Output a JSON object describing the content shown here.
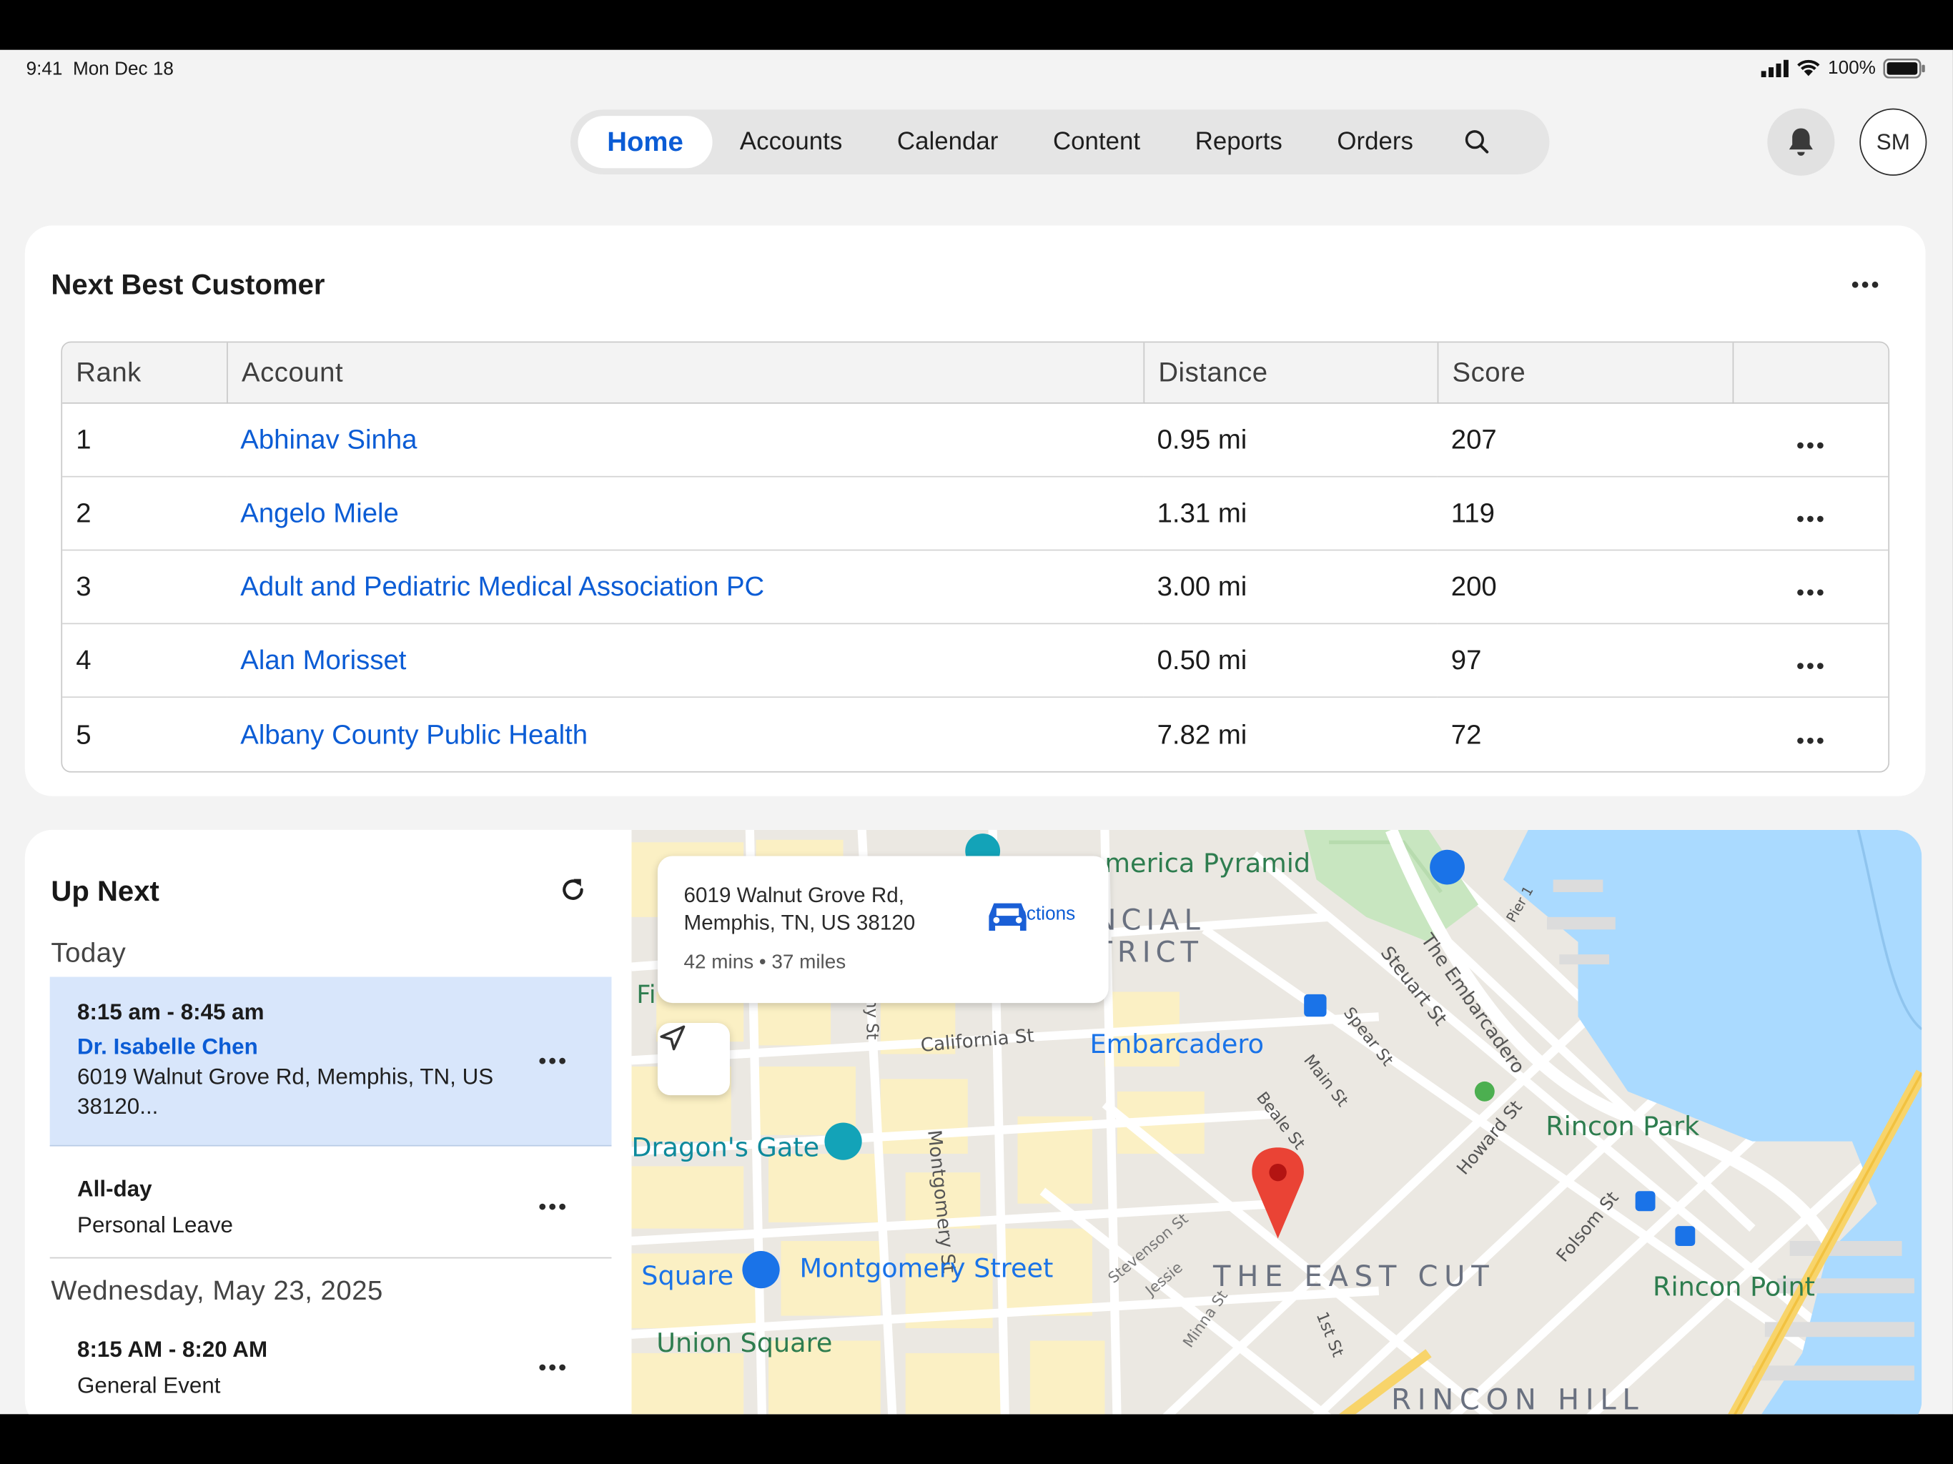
{
  "status": {
    "time": "9:41",
    "date": "Mon Dec 18",
    "battery": "100%"
  },
  "nav": {
    "tabs": [
      "Home",
      "Accounts",
      "Calendar",
      "Content",
      "Reports",
      "Orders"
    ],
    "active": "Home",
    "avatar_initials": "SM"
  },
  "nbc": {
    "title": "Next Best Customer",
    "columns": [
      "Rank",
      "Account",
      "Distance",
      "Score",
      ""
    ],
    "rows": [
      {
        "rank": "1",
        "account": "Abhinav Sinha",
        "distance": "0.95 mi",
        "score": "207"
      },
      {
        "rank": "2",
        "account": "Angelo Miele",
        "distance": "1.31 mi",
        "score": "119"
      },
      {
        "rank": "3",
        "account": "Adult and Pediatric Medical Association PC",
        "distance": "3.00 mi",
        "score": "200"
      },
      {
        "rank": "4",
        "account": "Alan Morisset",
        "distance": "0.50 mi",
        "score": "97"
      },
      {
        "rank": "5",
        "account": "Albany County Public Health",
        "distance": "7.82 mi",
        "score": "72"
      }
    ]
  },
  "upnext": {
    "title": "Up Next",
    "today_label": "Today",
    "events": [
      {
        "time": "8:15 am - 8:45 am",
        "name": "Dr. Isabelle Chen",
        "address": "6019 Walnut Grove Rd, Memphis, TN, US 38120..."
      },
      {
        "time": "All-day",
        "subtitle": "Personal Leave"
      }
    ],
    "second_day_label": "Wednesday, May 23, 2025",
    "second_day_events": [
      {
        "time": "8:15 AM - 8:20 AM",
        "subtitle": "General Event"
      }
    ]
  },
  "map": {
    "directions": {
      "address_line1": "6019 Walnut Grove Rd,",
      "address_line2": "Memphis, TN, US 38120",
      "meta": "42 mins • 37 miles",
      "button_label": "Directions"
    },
    "labels": {
      "pyramid": "merica Pyramid",
      "financial1": "NCIAL",
      "financial2": "TRICT",
      "fi": "Fi",
      "california": "California St",
      "embarcadero": "Embarcadero",
      "dragons_gate": "Dragon's Gate",
      "montgomery_st": "Montgomery St",
      "square": "Square",
      "montgomery_street": "Montgomery Street",
      "union_square": "Union Square",
      "east_cut": "THE EAST CUT",
      "rincon_park": "Rincon Park",
      "rincon_point": "Rincon Point",
      "rincon_hill": "RINCON HILL",
      "embarcadero_road": "The Embarcadero",
      "steuart": "Steuart St",
      "spear": "Spear St",
      "main": "Main St",
      "beale": "Beale St",
      "howard": "Howard St",
      "folsom": "Folsom St",
      "stevenson": "Stevenson St",
      "jessie": "Jessie",
      "minna": "Minna St",
      "first_st": "1st St",
      "pier": "Pier 1",
      "ny_st": "ny St"
    },
    "colors": {
      "water": "#aadaff",
      "land": "#f2efe9",
      "block": "#fbf0c4",
      "park": "#c8e6c0",
      "pin": "#ea4335"
    }
  }
}
